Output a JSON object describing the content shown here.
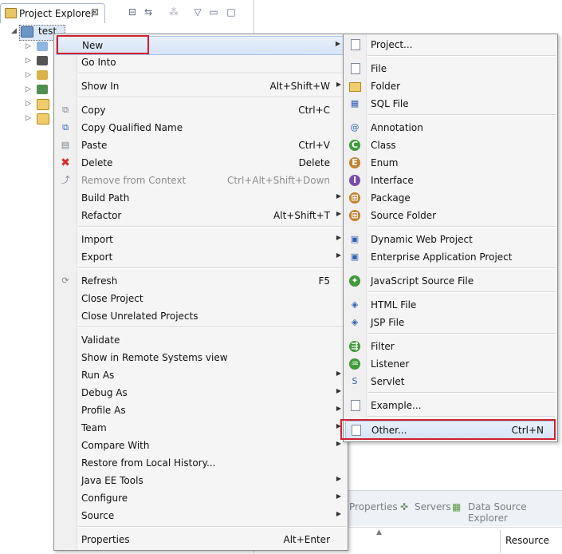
{
  "explorer": {
    "tab_label": "Project Explorer",
    "tab_close": "⊠",
    "tree_root": "test"
  },
  "bottom": {
    "tabs": [
      "Properties",
      "Servers",
      "Data Source Explorer"
    ],
    "column_header": "Resource"
  },
  "context_menu": {
    "items": [
      {
        "label": "New",
        "shortcut": "",
        "submenu": true,
        "icon": ""
      },
      {
        "label": "Go Into",
        "shortcut": "",
        "submenu": false,
        "icon": ""
      },
      {
        "label": "Show In",
        "shortcut": "Alt+Shift+W",
        "submenu": true,
        "icon": ""
      },
      {
        "label": "Copy",
        "shortcut": "Ctrl+C",
        "submenu": false,
        "icon": "copy-icon"
      },
      {
        "label": "Copy Qualified Name",
        "shortcut": "",
        "submenu": false,
        "icon": "copy-qualified-icon"
      },
      {
        "label": "Paste",
        "shortcut": "Ctrl+V",
        "submenu": false,
        "icon": "paste-icon"
      },
      {
        "label": "Delete",
        "shortcut": "Delete",
        "submenu": false,
        "icon": "delete-icon"
      },
      {
        "label": "Remove from Context",
        "shortcut": "Ctrl+Alt+Shift+Down",
        "submenu": false,
        "icon": "remove-context-icon",
        "disabled": true
      },
      {
        "label": "Build Path",
        "shortcut": "",
        "submenu": true,
        "icon": ""
      },
      {
        "label": "Refactor",
        "shortcut": "Alt+Shift+T",
        "submenu": true,
        "icon": ""
      },
      {
        "label": "Import",
        "shortcut": "",
        "submenu": true,
        "icon": ""
      },
      {
        "label": "Export",
        "shortcut": "",
        "submenu": true,
        "icon": ""
      },
      {
        "label": "Refresh",
        "shortcut": "F5",
        "submenu": false,
        "icon": "refresh-icon"
      },
      {
        "label": "Close Project",
        "shortcut": "",
        "submenu": false,
        "icon": ""
      },
      {
        "label": "Close Unrelated Projects",
        "shortcut": "",
        "submenu": false,
        "icon": ""
      },
      {
        "label": "Validate",
        "shortcut": "",
        "submenu": false,
        "icon": ""
      },
      {
        "label": "Show in Remote Systems view",
        "shortcut": "",
        "submenu": false,
        "icon": ""
      },
      {
        "label": "Run As",
        "shortcut": "",
        "submenu": true,
        "icon": ""
      },
      {
        "label": "Debug As",
        "shortcut": "",
        "submenu": true,
        "icon": ""
      },
      {
        "label": "Profile As",
        "shortcut": "",
        "submenu": true,
        "icon": ""
      },
      {
        "label": "Team",
        "shortcut": "",
        "submenu": true,
        "icon": ""
      },
      {
        "label": "Compare With",
        "shortcut": "",
        "submenu": true,
        "icon": ""
      },
      {
        "label": "Restore from Local History...",
        "shortcut": "",
        "submenu": false,
        "icon": ""
      },
      {
        "label": "Java EE Tools",
        "shortcut": "",
        "submenu": true,
        "icon": ""
      },
      {
        "label": "Configure",
        "shortcut": "",
        "submenu": true,
        "icon": ""
      },
      {
        "label": "Source",
        "shortcut": "",
        "submenu": true,
        "icon": ""
      },
      {
        "label": "Properties",
        "shortcut": "Alt+Enter",
        "submenu": false,
        "icon": ""
      }
    ]
  },
  "new_submenu": {
    "items": [
      {
        "label": "Project...",
        "shortcut": "",
        "icon": "new-project-icon"
      },
      {
        "label": "File",
        "shortcut": "",
        "icon": "file-icon"
      },
      {
        "label": "Folder",
        "shortcut": "",
        "icon": "folder-icon"
      },
      {
        "label": "SQL File",
        "shortcut": "",
        "icon": "sql-file-icon"
      },
      {
        "label": "Annotation",
        "shortcut": "",
        "icon": "annotation-icon"
      },
      {
        "label": "Class",
        "shortcut": "",
        "icon": "class-icon"
      },
      {
        "label": "Enum",
        "shortcut": "",
        "icon": "enum-icon"
      },
      {
        "label": "Interface",
        "shortcut": "",
        "icon": "interface-icon"
      },
      {
        "label": "Package",
        "shortcut": "",
        "icon": "package-icon"
      },
      {
        "label": "Source Folder",
        "shortcut": "",
        "icon": "source-folder-icon"
      },
      {
        "label": "Dynamic Web Project",
        "shortcut": "",
        "icon": "dynamic-web-project-icon"
      },
      {
        "label": "Enterprise Application Project",
        "shortcut": "",
        "icon": "enterprise-app-project-icon"
      },
      {
        "label": "JavaScript Source File",
        "shortcut": "",
        "icon": "javascript-file-icon"
      },
      {
        "label": "HTML File",
        "shortcut": "",
        "icon": "html-file-icon"
      },
      {
        "label": "JSP File",
        "shortcut": "",
        "icon": "jsp-file-icon"
      },
      {
        "label": "Filter",
        "shortcut": "",
        "icon": "filter-icon"
      },
      {
        "label": "Listener",
        "shortcut": "",
        "icon": "listener-icon"
      },
      {
        "label": "Servlet",
        "shortcut": "",
        "icon": "servlet-icon"
      },
      {
        "label": "Example...",
        "shortcut": "",
        "icon": "example-icon"
      },
      {
        "label": "Other...",
        "shortcut": "Ctrl+N",
        "icon": "other-icon"
      }
    ]
  },
  "colors": {
    "highlight_border": "#d11f2d",
    "menu_bg": "#f5f5f5"
  }
}
